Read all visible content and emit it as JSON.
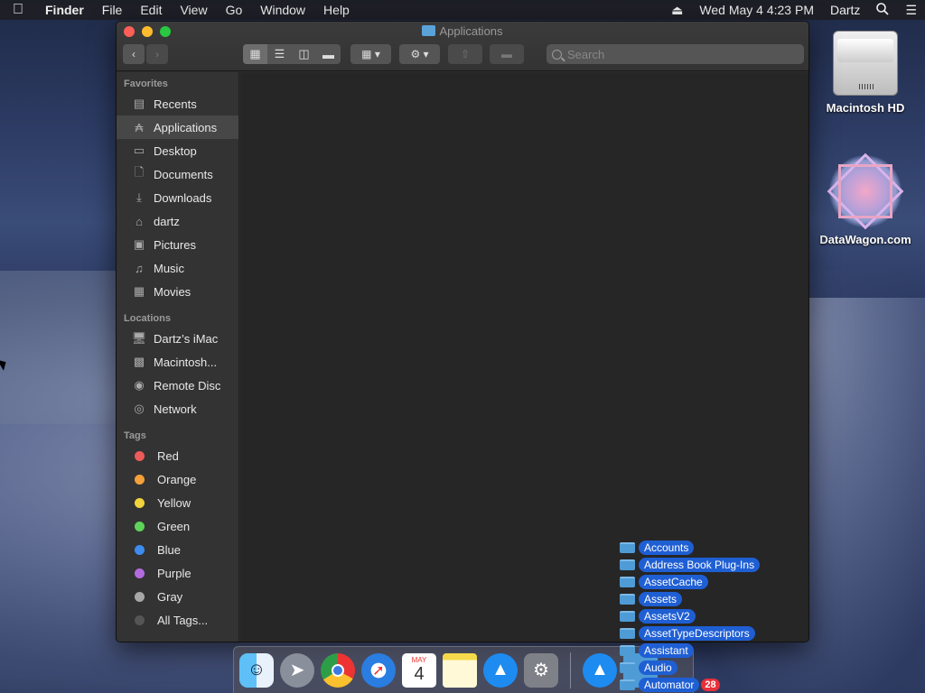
{
  "menubar": {
    "apple": "",
    "items": [
      "Finder",
      "File",
      "Edit",
      "View",
      "Go",
      "Window",
      "Help"
    ],
    "datetime": "Wed May 4  4:23 PM",
    "user": "Dartz"
  },
  "window": {
    "title": "Applications",
    "search_placeholder": "Search"
  },
  "sidebar": {
    "favorites_header": "Favorites",
    "favorites": [
      "Recents",
      "Applications",
      "Desktop",
      "Documents",
      "Downloads",
      "dartz",
      "Pictures",
      "Music",
      "Movies"
    ],
    "locations_header": "Locations",
    "locations": [
      "Dartz’s iMac",
      "Macintosh...",
      "Remote Disc",
      "Network"
    ],
    "tags_header": "Tags",
    "tags": [
      {
        "label": "Red",
        "color": "#ec5a5a"
      },
      {
        "label": "Orange",
        "color": "#f5a03a"
      },
      {
        "label": "Yellow",
        "color": "#f3d33b"
      },
      {
        "label": "Green",
        "color": "#5fd25a"
      },
      {
        "label": "Blue",
        "color": "#3d8cf0"
      },
      {
        "label": "Purple",
        "color": "#b36be0"
      },
      {
        "label": "Gray",
        "color": "#a7a7a7"
      },
      {
        "label": "All Tags...",
        "color": "#555555"
      }
    ]
  },
  "desktop": {
    "icon1": "Macintosh HD",
    "icon2": "DataWagon.com"
  },
  "drag_items": [
    "Accounts",
    "Address Book Plug-Ins",
    "AssetCache",
    "Assets",
    "AssetsV2",
    "AssetTypeDescriptors",
    "Assistant",
    "Audio",
    "Automator"
  ],
  "drag_count": "28",
  "dock": {
    "calendar_month": "MAY",
    "calendar_day": "4"
  }
}
